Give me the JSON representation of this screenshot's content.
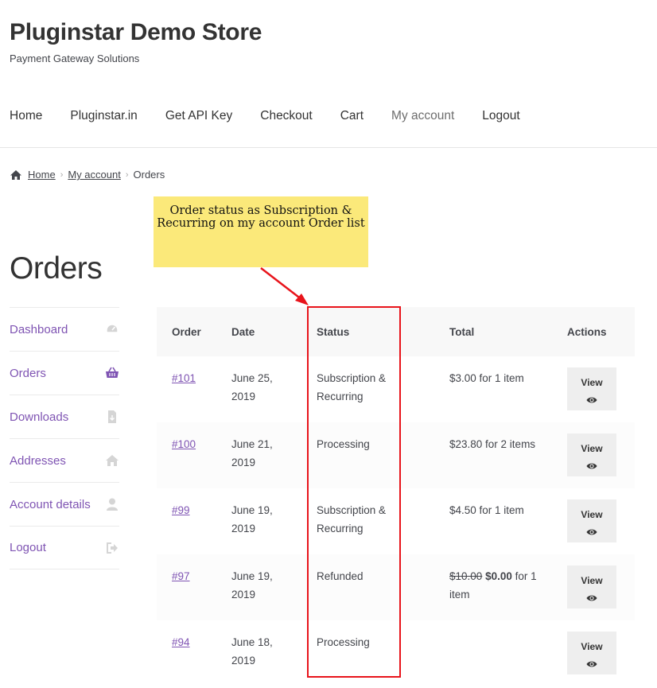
{
  "site": {
    "title": "Pluginstar Demo Store",
    "tagline": "Payment Gateway Solutions"
  },
  "nav": {
    "items": [
      {
        "label": "Home"
      },
      {
        "label": "Pluginstar.in"
      },
      {
        "label": "Get API Key"
      },
      {
        "label": "Checkout"
      },
      {
        "label": "Cart"
      },
      {
        "label": "My account",
        "current": true
      },
      {
        "label": "Logout"
      }
    ]
  },
  "breadcrumb": {
    "home": "Home",
    "my_account": "My account",
    "current": "Orders"
  },
  "callout": {
    "text": "Order status as Subscription & Recurring on my account Order list"
  },
  "page_title": "Orders",
  "account_nav": {
    "items": [
      {
        "label": "Dashboard",
        "icon": "dashboard-icon"
      },
      {
        "label": "Orders",
        "icon": "basket-icon",
        "active": true
      },
      {
        "label": "Downloads",
        "icon": "file-download-icon"
      },
      {
        "label": "Addresses",
        "icon": "home-icon"
      },
      {
        "label": "Account details",
        "icon": "user-icon"
      },
      {
        "label": "Logout",
        "icon": "sign-out-icon"
      }
    ]
  },
  "orders": {
    "headers": {
      "order": "Order",
      "date": "Date",
      "status": "Status",
      "total": "Total",
      "actions": "Actions"
    },
    "view_label": "View",
    "rows": [
      {
        "number": "#101",
        "date_line1": "June 25,",
        "date_line2": "2019",
        "status_line1": "Subscription &",
        "status_line2": "Recurring",
        "total": "$3.00 for 1 item"
      },
      {
        "number": "#100",
        "date_line1": "June 21,",
        "date_line2": "2019",
        "status_line1": "Processing",
        "status_line2": "",
        "total": "$23.80 for 2 items"
      },
      {
        "number": "#99",
        "date_line1": "June 19,",
        "date_line2": "2019",
        "status_line1": "Subscription &",
        "status_line2": "Recurring",
        "total": "$4.50 for 1 item"
      },
      {
        "number": "#97",
        "date_line1": "June 19,",
        "date_line2": "2019",
        "status_line1": "Refunded",
        "status_line2": "",
        "total_old": "$10.00",
        "total_new": "$0.00",
        "total_suffix": "for 1",
        "total_line2": "item"
      },
      {
        "number": "#94",
        "date_line1": "June 18,",
        "date_line2": "2019",
        "status_line1": "Processing",
        "status_line2": "",
        "total": ""
      }
    ]
  },
  "colors": {
    "link_purple": "#7f54b3",
    "callout_yellow": "#fbe97a",
    "highlight_red": "#e8141b"
  }
}
